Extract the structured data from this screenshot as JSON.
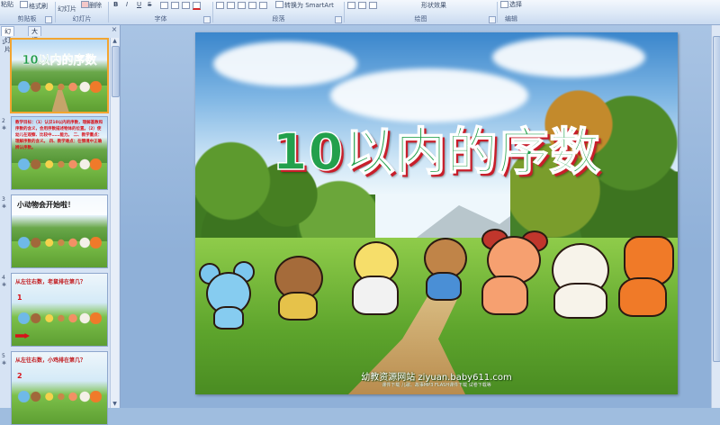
{
  "ribbon": {
    "paste_partial": "粘贴",
    "format_painter": "格式刷",
    "new_slide": "幻灯片",
    "delete": "删除",
    "bold": "B",
    "italic": "I",
    "underline": "U",
    "strike": "S",
    "convert_smartart": "转换为 SmartArt",
    "shape_effects": "形状效果",
    "select": "选择",
    "groups": [
      "剪贴板",
      "幻灯片",
      "字体",
      "段落",
      "绘图",
      "编辑"
    ]
  },
  "panel": {
    "tab_slides": "幻灯片",
    "tab_outline": "大纲",
    "close": "×"
  },
  "thumbnails": [
    {
      "num": "1",
      "anim": "",
      "title": "10以内的序数"
    },
    {
      "num": "2",
      "anim": "✱",
      "text": "教学目标：（1）认识10以内的序数，理解基数和序数的含义，会用序数描述物体的位置。（2）使幼儿在观察、比较中……能力。 二、教学重点：理解序数的含义。 四、教学难点：在情境中正确辨认序数。"
    },
    {
      "num": "3",
      "anim": "✱",
      "caption": "小动物会开始啦！"
    },
    {
      "num": "4",
      "anim": "✱",
      "note": "从左往右数，老鼠排在第几？",
      "red_num": "1"
    },
    {
      "num": "5",
      "anim": "✱",
      "note": "从左往右数，小鸡排在第几？",
      "red_num": "2"
    }
  ],
  "slide": {
    "title": "10以内的序数",
    "watermark": "幼教资源网站 ziyuan.baby611.com",
    "watermark_sub": "课件下载 儿歌、故事MP3 FLASH课件下载 试卷下载等"
  },
  "colors": {
    "title_fill": "#23a04c",
    "title_shadow": "#c81e2a",
    "selected_thumb_border": "#f3a530"
  }
}
